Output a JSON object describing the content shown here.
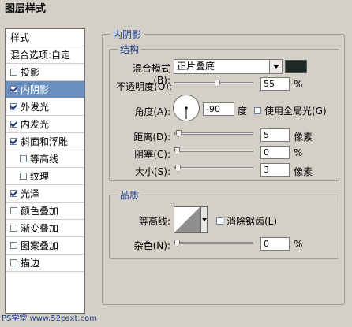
{
  "window": {
    "title": "图层样式"
  },
  "left_panel": {
    "items": [
      {
        "label": "样式",
        "checkbox": false,
        "checked": false,
        "selected": false,
        "header": true
      },
      {
        "label": "混合选项:自定",
        "checkbox": false,
        "checked": false,
        "selected": false,
        "header": true
      },
      {
        "label": "投影",
        "checkbox": true,
        "checked": false,
        "selected": false
      },
      {
        "label": "内阴影",
        "checkbox": true,
        "checked": true,
        "selected": true
      },
      {
        "label": "外发光",
        "checkbox": true,
        "checked": true,
        "selected": false
      },
      {
        "label": "内发光",
        "checkbox": true,
        "checked": true,
        "selected": false
      },
      {
        "label": "斜面和浮雕",
        "checkbox": true,
        "checked": true,
        "selected": false
      },
      {
        "label": "等高线",
        "checkbox": true,
        "checked": false,
        "selected": false,
        "indent": true
      },
      {
        "label": "纹理",
        "checkbox": true,
        "checked": false,
        "selected": false,
        "indent": true
      },
      {
        "label": "光泽",
        "checkbox": true,
        "checked": true,
        "selected": false
      },
      {
        "label": "颜色叠加",
        "checkbox": true,
        "checked": false,
        "selected": false
      },
      {
        "label": "渐变叠加",
        "checkbox": true,
        "checked": false,
        "selected": false
      },
      {
        "label": "图案叠加",
        "checkbox": true,
        "checked": false,
        "selected": false
      },
      {
        "label": "描边",
        "checkbox": true,
        "checked": false,
        "selected": false
      }
    ]
  },
  "inner_shadow": {
    "title": "内阴影",
    "structure": {
      "title": "结构",
      "blend_mode_label": "混合模式(B):",
      "blend_mode_value": "正片叠底",
      "shadow_color": "#1f2a26",
      "opacity_label": "不透明度(O):",
      "opacity_value": "55",
      "opacity_unit": "%",
      "opacity_level": 0.55,
      "angle_label": "角度(A):",
      "angle_value": "-90",
      "angle_unit": "度",
      "global_light_label": "使用全局光(G)",
      "global_light_checked": false,
      "distance_label": "距离(D):",
      "distance_value": "5",
      "distance_unit": "像素",
      "distance_level": 0.02,
      "choke_label": "阻塞(C):",
      "choke_value": "0",
      "choke_unit": "%",
      "choke_level": 0,
      "size_label": "大小(S):",
      "size_value": "3",
      "size_unit": "像素",
      "size_level": 0.01
    },
    "quality": {
      "title": "品质",
      "contour_label": "等高线:",
      "antialias_label": "消除锯齿(L)",
      "antialias_checked": false,
      "noise_label": "杂色(N):",
      "noise_value": "0",
      "noise_unit": "%",
      "noise_level": 0
    }
  },
  "watermark": {
    "text": "PS学堂 www.52psxt.com"
  }
}
